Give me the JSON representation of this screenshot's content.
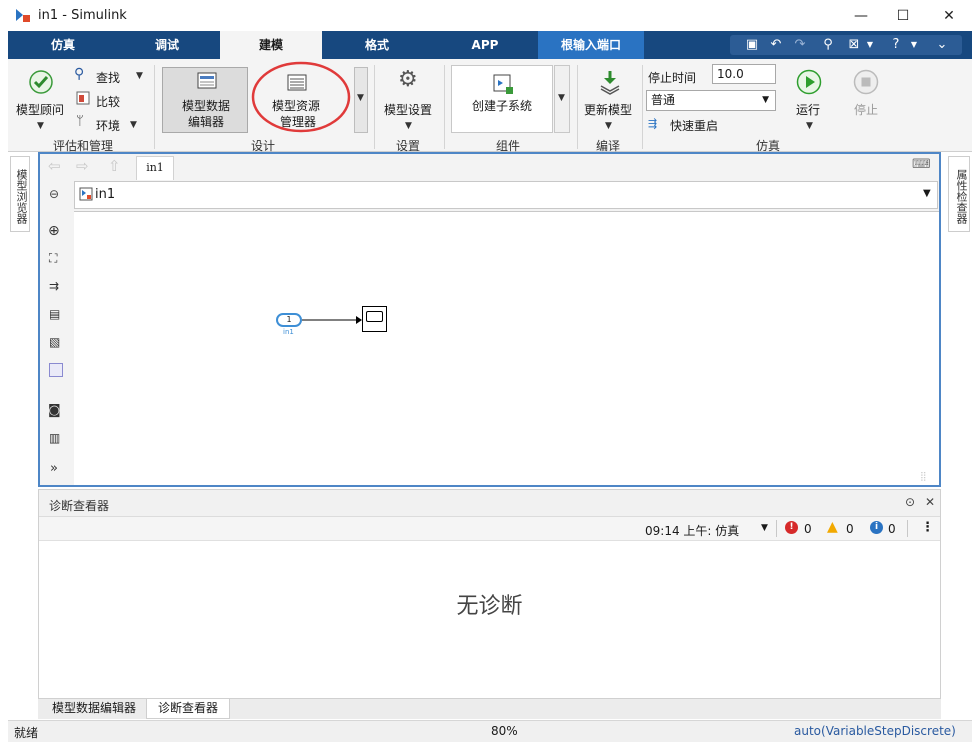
{
  "window": {
    "title": "in1 - Simulink",
    "minimize": "—",
    "maximize": "☐",
    "close": "✕"
  },
  "ribbon_tabs": [
    {
      "label": "仿真"
    },
    {
      "label": "调试"
    },
    {
      "label": "建模"
    },
    {
      "label": "格式"
    },
    {
      "label": "APP"
    },
    {
      "label": "根输入端口"
    }
  ],
  "toolstrip": {
    "model_advisor": "模型顾问",
    "find": "查找",
    "compare": "比较",
    "environment": "环境",
    "group_evaluate": "评估和管理",
    "model_data_editor_1": "模型数据",
    "model_data_editor_2": "编辑器",
    "model_explorer_1": "模型资源",
    "model_explorer_2": "管理器",
    "group_design": "设计",
    "model_settings": "模型设置",
    "group_setup": "设置",
    "create_subsystem": "创建子系统",
    "group_component": "组件",
    "update_model": "更新模型",
    "group_compile": "编译",
    "stop_time_label": "停止时间",
    "stop_time_value": "10.0",
    "sim_mode": "普通",
    "fast_restart": "快速重启",
    "run": "运行",
    "stop": "停止",
    "group_simulate": "仿真"
  },
  "side_tabs": {
    "left": "模型浏览器",
    "right": "属性检查器"
  },
  "editor": {
    "tab": "in1",
    "breadcrumb": "in1",
    "block_port_number": "1",
    "block_name": "in1"
  },
  "diagnostics": {
    "title": "诊断查看器",
    "timestamp": "09:14 上午: 仿真",
    "errors": "0",
    "warnings": "0",
    "infos": "0",
    "empty_message": "无诊断"
  },
  "bottom_tabs": [
    {
      "label": "模型数据编辑器"
    },
    {
      "label": "诊断查看器"
    }
  ],
  "status": {
    "left": "就绪",
    "zoom": "80%",
    "solver": "auto(VariableStepDiscrete)"
  },
  "colors": {
    "ribbon_blue": "#17487f",
    "context_tab": "#2a73c2",
    "highlight_circle": "#e03a3a",
    "run_green": "#2e9e2e",
    "editor_border": "#4e86c6",
    "port_blue": "#3e8fd6"
  }
}
